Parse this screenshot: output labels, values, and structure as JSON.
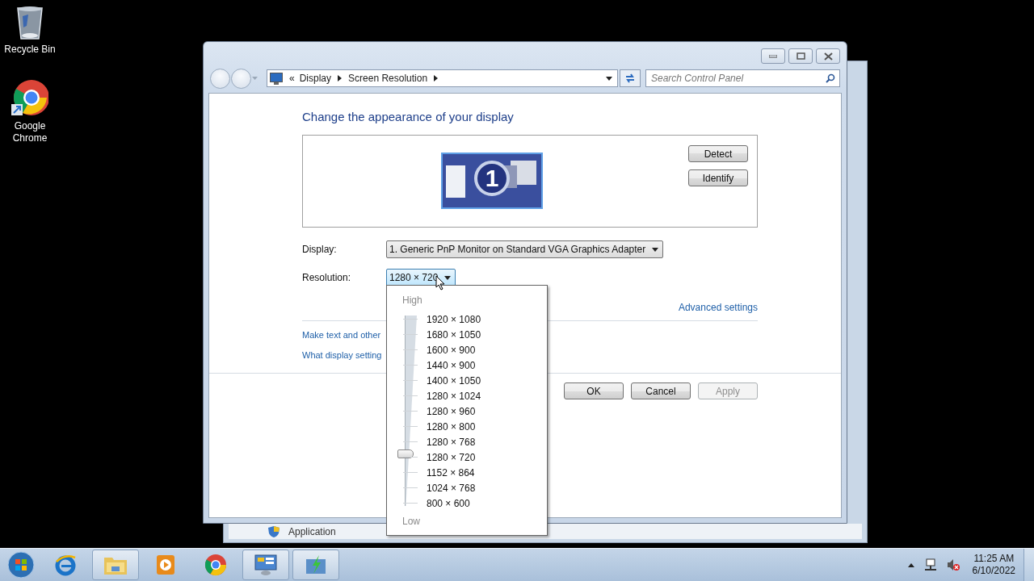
{
  "desktop": {
    "icons": [
      {
        "kind": "recycle-bin",
        "label": "Recycle Bin"
      },
      {
        "kind": "chrome",
        "label": "Google Chrome"
      }
    ]
  },
  "background_window": {
    "label": "Application"
  },
  "window": {
    "address": {
      "overflow_glyph": "«",
      "crumbs": [
        "Display",
        "Screen Resolution"
      ]
    },
    "search": {
      "placeholder": "Search Control Panel"
    },
    "heading": "Change the appearance of your display",
    "monitor_label": "1",
    "side_buttons": [
      "Detect",
      "Identify"
    ],
    "display": {
      "label": "Display:",
      "value": "1. Generic PnP Monitor on Standard VGA Graphics Adapter"
    },
    "resolution": {
      "label": "Resolution:",
      "value": "1280 × 720",
      "open": true
    },
    "advanced_link": "Advanced settings",
    "links": [
      "Make text and other",
      "What display setting"
    ],
    "buttons": [
      {
        "label": "OK",
        "disabled": false
      },
      {
        "label": "Cancel",
        "disabled": false
      },
      {
        "label": "Apply",
        "disabled": true
      }
    ]
  },
  "resolution_menu": {
    "high_label": "High",
    "low_label": "Low",
    "level": 0.25,
    "options": [
      "1920 × 1080",
      "1680 × 1050",
      "1600 × 900",
      "1440 × 900",
      "1400 × 1050",
      "1280 × 1024",
      "1280 × 960",
      "1280 × 800",
      "1280 × 768",
      "1280 × 720",
      "1152 × 864",
      "1024 × 768",
      "800 × 600"
    ]
  },
  "taskbar": {
    "items": [
      {
        "kind": "ie",
        "highlighted": false
      },
      {
        "kind": "folder",
        "highlighted": true
      },
      {
        "kind": "media",
        "highlighted": false
      },
      {
        "kind": "chrome",
        "highlighted": false
      },
      {
        "kind": "control-panel",
        "highlighted": true
      },
      {
        "kind": "green-app",
        "highlighted": true
      }
    ],
    "clock": {
      "time": "11:25 AM",
      "date": "6/10/2022"
    }
  }
}
